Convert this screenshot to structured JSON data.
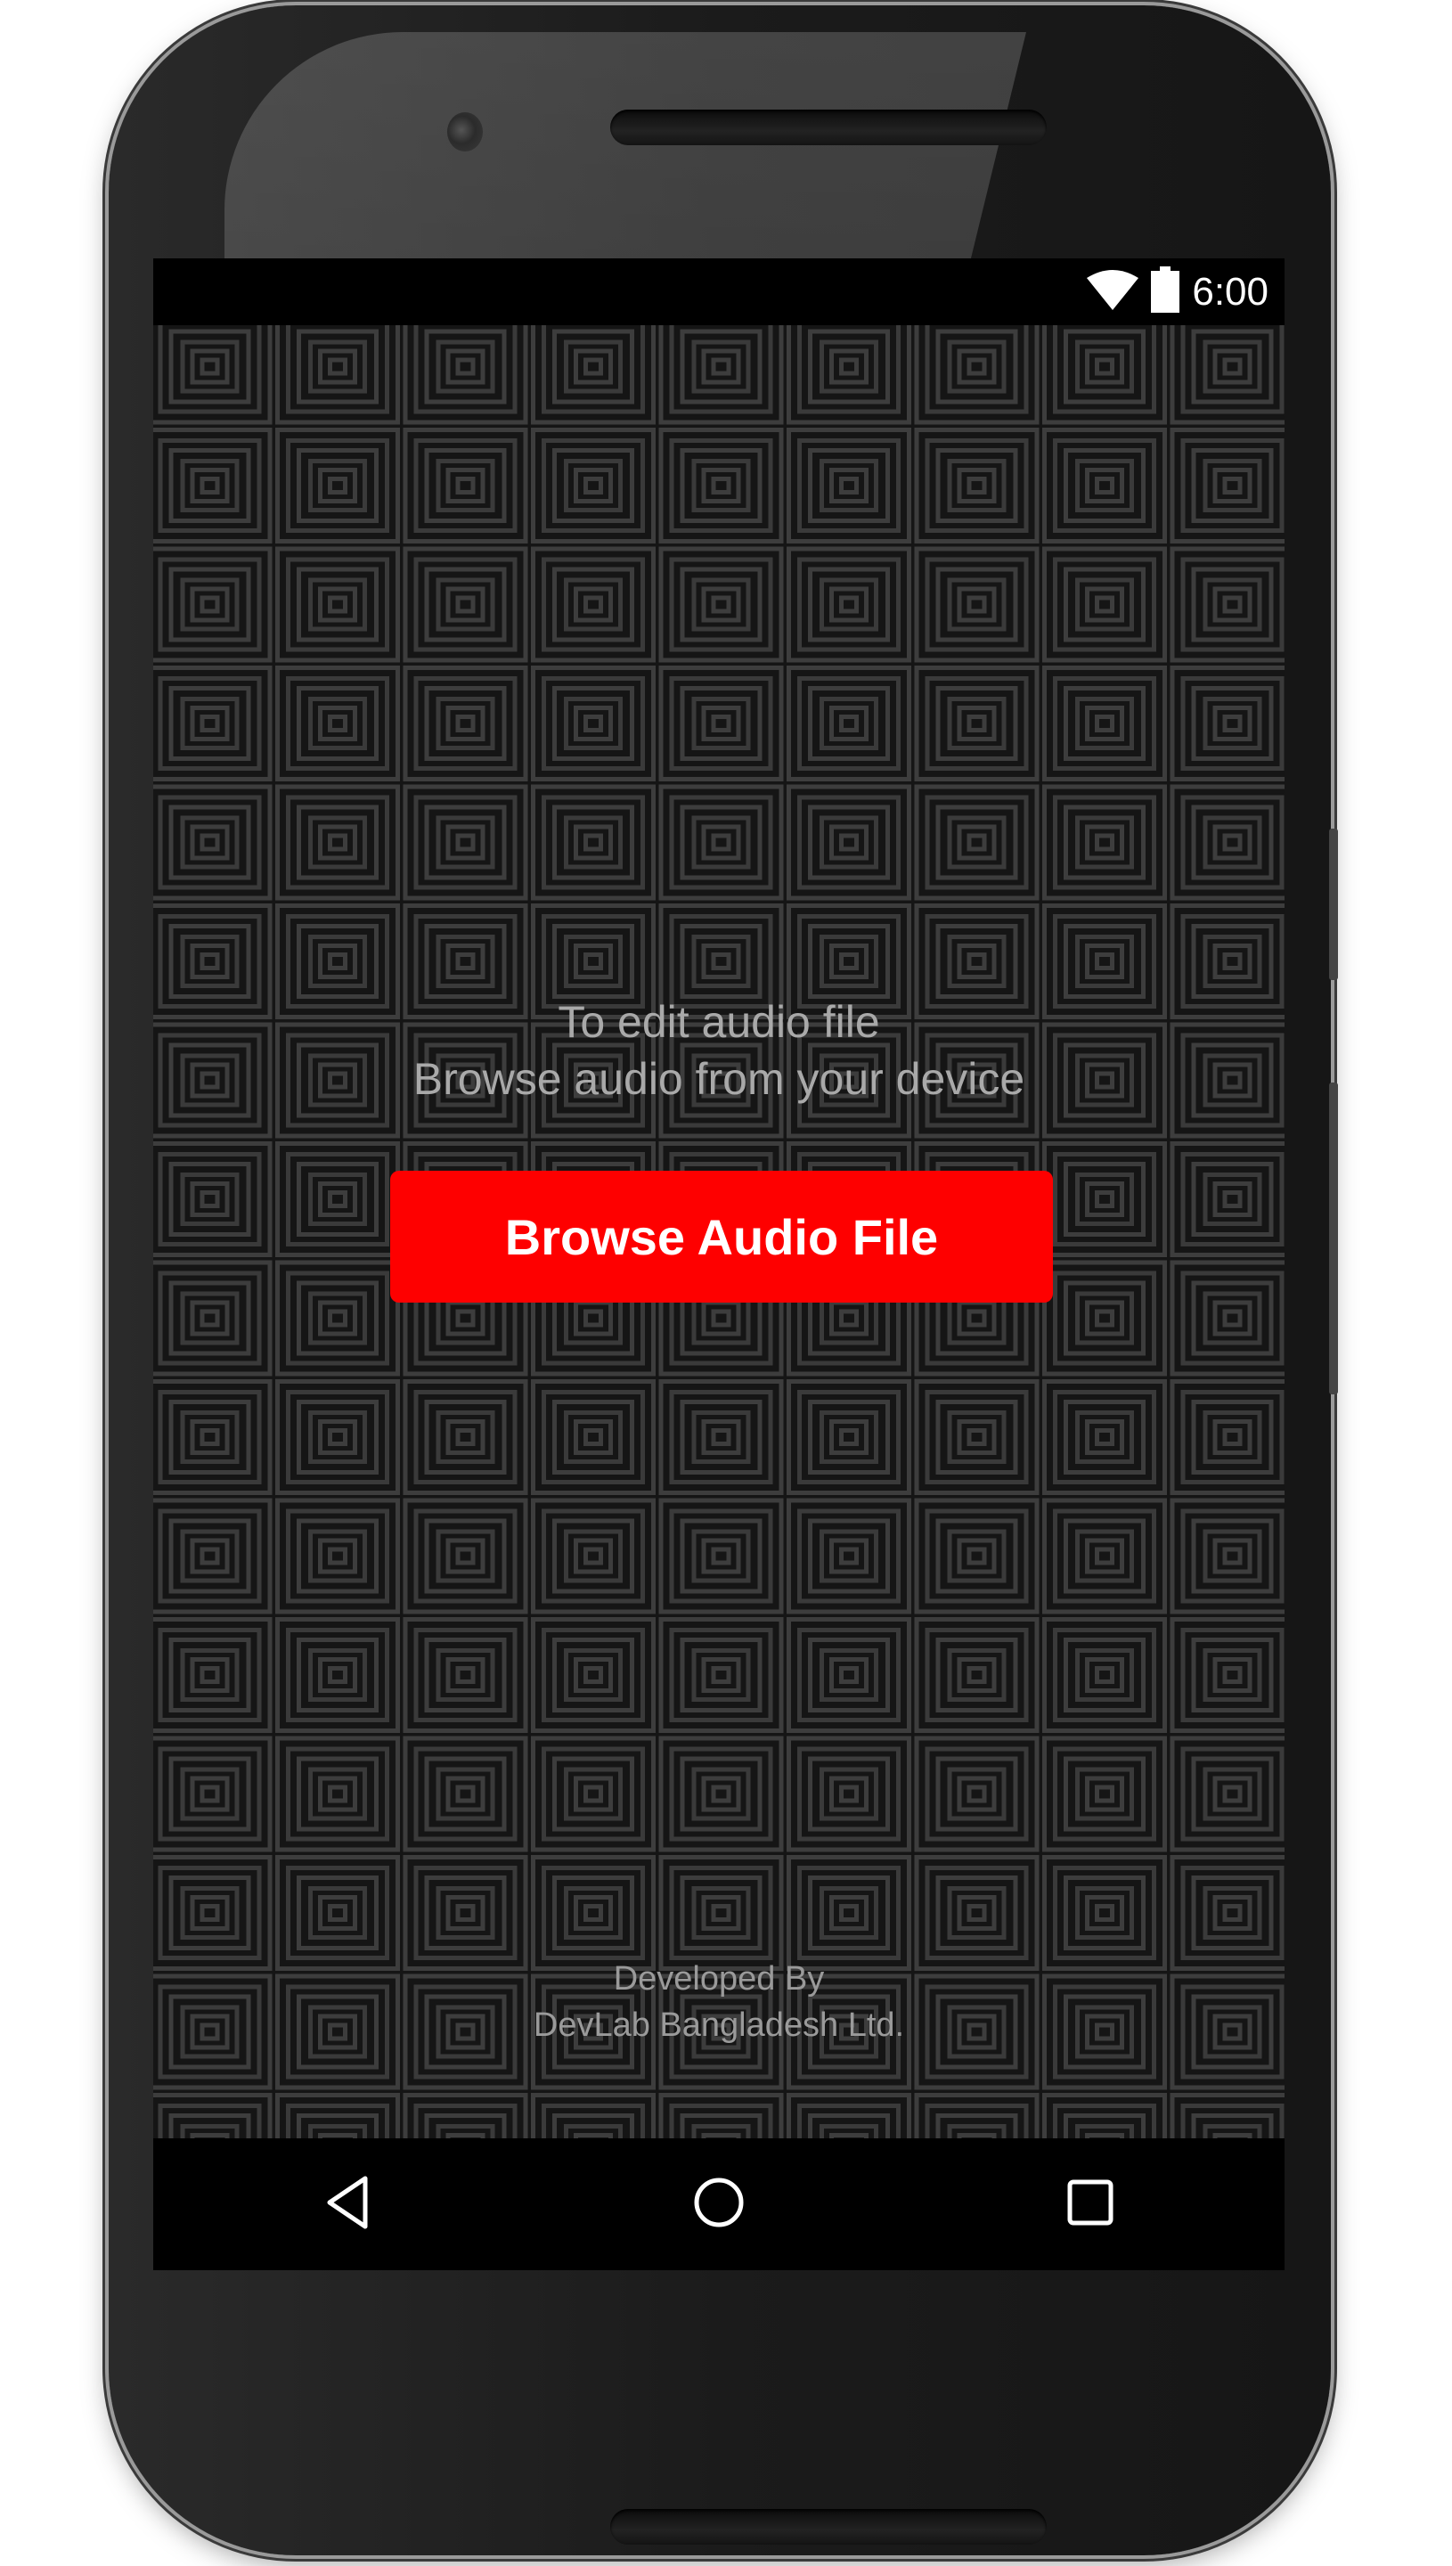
{
  "status_bar": {
    "time": "6:00",
    "icons": [
      "wifi-icon",
      "battery-icon"
    ]
  },
  "main": {
    "instruction_line1": "To edit audio file",
    "instruction_line2": "Browse audio from your device",
    "browse_button_label": "Browse Audio File",
    "accent_color": "#fe0000"
  },
  "footer": {
    "line1": "Developed By",
    "line2": "DevLab Bangladesh Ltd."
  },
  "navigation_bar": {
    "buttons": [
      "back",
      "home",
      "recents"
    ]
  }
}
